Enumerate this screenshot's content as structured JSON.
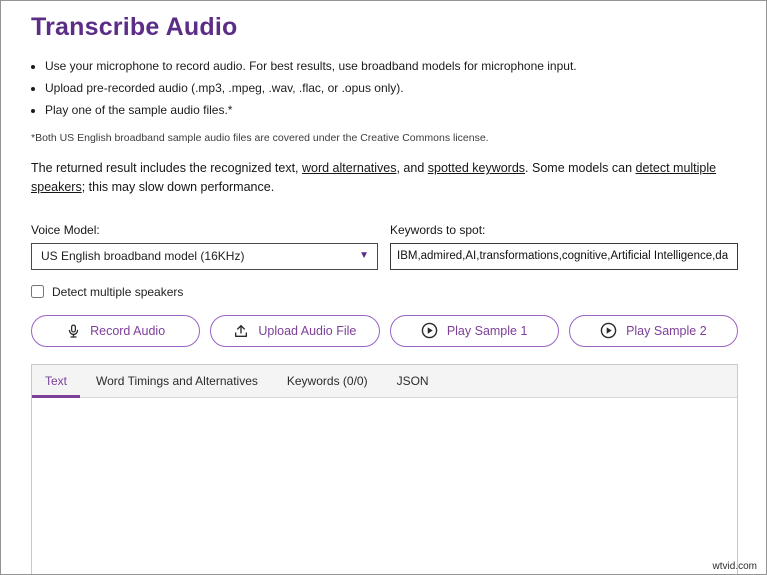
{
  "page": {
    "title": "Transcribe Audio",
    "bullets": [
      "Use your microphone to record audio. For best results, use broadband models for microphone input.",
      "Upload pre-recorded audio (.mp3, .mpeg, .wav, .flac, or .opus only).",
      "Play one of the sample audio files.*"
    ],
    "footnote": "*Both US English broadband sample audio files are covered under the Creative Commons license.",
    "description": {
      "part1": "The returned result includes the recognized text, ",
      "link1": "word alternatives",
      "part2": ", and ",
      "link2": "spotted keywords",
      "part3": ". Some models can ",
      "link3": "detect multiple speakers",
      "part4": "; this may slow down performance."
    }
  },
  "form": {
    "voice_model_label": "Voice Model:",
    "voice_model_value": "US English broadband model (16KHz)",
    "keywords_label": "Keywords to spot:",
    "keywords_value": "IBM,admired,AI,transformations,cognitive,Artificial Intelligence,da",
    "detect_speakers_label": "Detect multiple speakers"
  },
  "buttons": {
    "record": "Record Audio",
    "upload": "Upload Audio File",
    "sample1": "Play Sample 1",
    "sample2": "Play Sample 2"
  },
  "tabs": [
    {
      "label": "Text",
      "active": true
    },
    {
      "label": "Word Timings and Alternatives",
      "active": false
    },
    {
      "label": "Keywords (0/0)",
      "active": false
    },
    {
      "label": "JSON",
      "active": false
    }
  ],
  "watermark": "wtvid.com",
  "colors": {
    "title": "#5c2d86",
    "accent": "#7d3f98",
    "pill-border": "#9b63c4"
  }
}
